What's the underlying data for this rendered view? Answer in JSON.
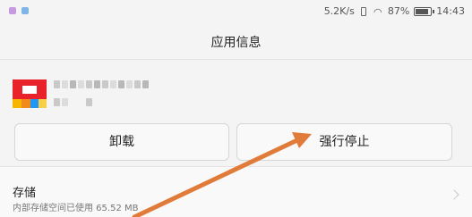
{
  "status_bar": {
    "network_speed": "5.2K/s",
    "battery_percent": "87%",
    "battery_level": 0.87,
    "time": "14:43",
    "icons": [
      "notification-icon",
      "notification-icon",
      "vibrate-icon",
      "wifi-icon",
      "battery-icon"
    ]
  },
  "header": {
    "title": "应用信息"
  },
  "buttons": {
    "uninstall": "卸载",
    "force_stop": "强行停止"
  },
  "storage": {
    "title": "存储",
    "detail": "内部存储空间已使用 65.52 MB"
  },
  "colors": {
    "annotation_arrow": "#e07b39",
    "app_icon_red": "#e8212b"
  }
}
